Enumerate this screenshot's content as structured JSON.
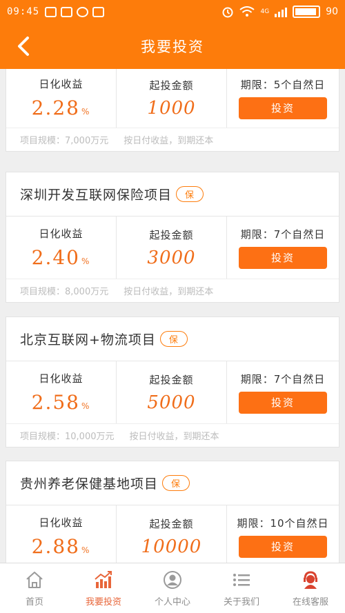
{
  "status_bar": {
    "time": "09:45",
    "network": "4G",
    "battery": "90"
  },
  "nav": {
    "title": "我要投资"
  },
  "projects": [
    {
      "rate_label": "日化收益",
      "rate": "2.28",
      "rate_unit": "%",
      "min_label": "起投金额",
      "min": "1000",
      "term": "期限：5个自然日",
      "button": "投资",
      "scale": "项目规模：7,000万元",
      "method": "按日付收益，到期还本"
    },
    {
      "name": "深圳开发互联网保险项目",
      "badge": "保",
      "rate_label": "日化收益",
      "rate": "2.40",
      "rate_unit": "%",
      "min_label": "起投金额",
      "min": "3000",
      "term": "期限：7个自然日",
      "button": "投资",
      "scale": "项目规模：8,000万元",
      "method": "按日付收益，到期还本"
    },
    {
      "name": "北京互联网+物流项目",
      "badge": "保",
      "rate_label": "日化收益",
      "rate": "2.58",
      "rate_unit": "%",
      "min_label": "起投金额",
      "min": "5000",
      "term": "期限：7个自然日",
      "button": "投资",
      "scale": "项目规模：10,000万元",
      "method": "按日付收益，到期还本"
    },
    {
      "name": "贵州养老保健基地项目",
      "badge": "保",
      "rate_label": "日化收益",
      "rate": "2.88",
      "rate_unit": "%",
      "min_label": "起投金额",
      "min": "10000",
      "term": "期限：10个自然日",
      "button": "投资"
    }
  ],
  "tabs": [
    {
      "label": "首页",
      "icon": "home-icon"
    },
    {
      "label": "我要投资",
      "icon": "chart-icon",
      "active": true
    },
    {
      "label": "个人中心",
      "icon": "user-icon"
    },
    {
      "label": "关于我们",
      "icon": "list-icon"
    },
    {
      "label": "在线客服",
      "icon": "service-icon"
    }
  ],
  "colors": {
    "brand": "#fd7c0b",
    "value": "#f06d1a",
    "tab_active": "#e8663a"
  }
}
